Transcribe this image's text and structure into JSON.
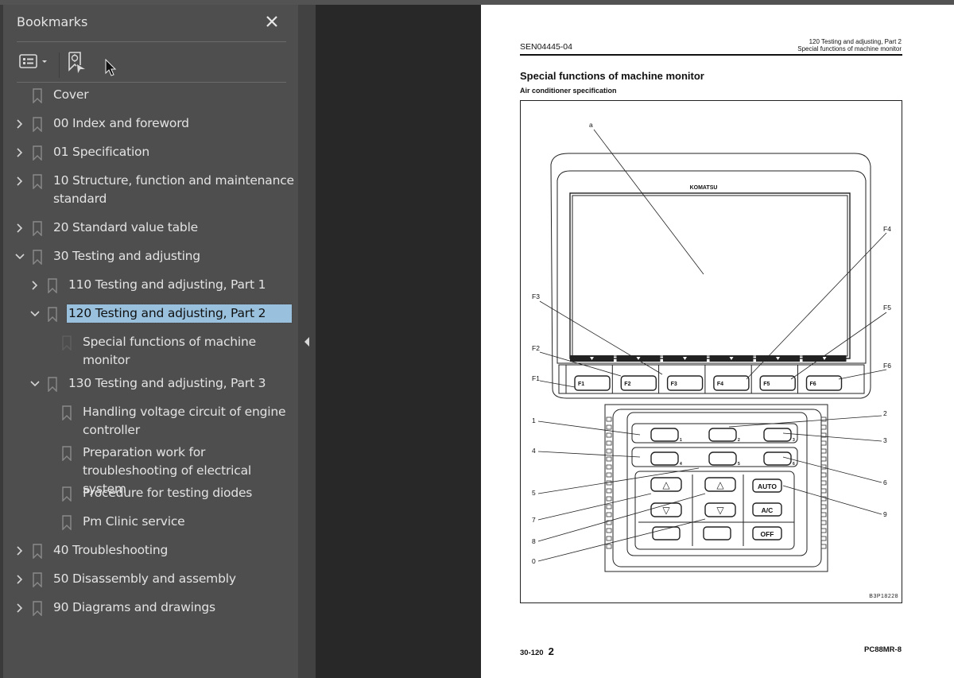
{
  "sidebar": {
    "title": "Bookmarks",
    "close_icon": "close-icon",
    "toolbar": {
      "options_icon": "bookmark-options-icon",
      "find_icon": "find-current-bookmark-icon"
    },
    "items": [
      {
        "label": "Cover",
        "level": 0,
        "expander": "none"
      },
      {
        "label": "00 Index and foreword",
        "level": 0,
        "expander": "collapsed"
      },
      {
        "label": "01 Specification",
        "level": 0,
        "expander": "collapsed"
      },
      {
        "label": "10 Structure, function and maintenance",
        "label2": "standard",
        "level": 0,
        "expander": "collapsed"
      },
      {
        "label": "20 Standard value table",
        "level": 0,
        "expander": "collapsed"
      },
      {
        "label": "30 Testing and adjusting",
        "level": 0,
        "expander": "expanded"
      },
      {
        "label": "110 Testing and adjusting, Part 1",
        "level": 1,
        "expander": "collapsed"
      },
      {
        "label": "120 Testing and adjusting, Part 2",
        "level": 1,
        "expander": "expanded",
        "selected": true
      },
      {
        "label": "Special functions of machine",
        "label2": "monitor",
        "level": 2,
        "expander": "none",
        "current": true
      },
      {
        "label": "130 Testing and adjusting, Part 3",
        "level": 1,
        "expander": "expanded"
      },
      {
        "label": "Handling voltage circuit of engine",
        "label2": "controller",
        "level": 2,
        "expander": "none"
      },
      {
        "label": "Preparation work for",
        "label2": "troubleshooting of electrical system",
        "level": 2,
        "expander": "none"
      },
      {
        "label": "Procedure for testing diodes",
        "level": 2,
        "expander": "none"
      },
      {
        "label": "Pm Clinic service",
        "level": 2,
        "expander": "none"
      },
      {
        "label": "40 Troubleshooting",
        "level": 0,
        "expander": "collapsed"
      },
      {
        "label": "50 Disassembly and assembly",
        "level": 0,
        "expander": "collapsed"
      },
      {
        "label": "90 Diagrams and drawings",
        "level": 0,
        "expander": "collapsed"
      }
    ]
  },
  "colors": {
    "selection": "#99c0dc",
    "panel_bg": "#4e4e4e",
    "viewer_bg": "#282828"
  },
  "page": {
    "doc_id": "SEN04445-04",
    "header_right_1": "120 Testing and adjusting, Part 2",
    "header_right_2": "Special functions of machine monitor",
    "title": "Special functions of machine monitor",
    "subtitle": "Air conditioner specification",
    "figure_code": "B3P18228",
    "footer_page": "30-120",
    "footer_rev": "2",
    "footer_model": "PC88MR-8",
    "figure": {
      "brand": "KOMATSU",
      "callouts_left": [
        "F3",
        "F2",
        "F1",
        "1",
        "4",
        "5",
        "7",
        "8",
        "0"
      ],
      "callouts_right": [
        "F4",
        "F5",
        "F6",
        "2",
        "3",
        "6",
        "9"
      ],
      "callout_top": "a",
      "fkeys": [
        "F1",
        "F2",
        "F3",
        "F4",
        "F5",
        "F6"
      ],
      "ac_buttons": [
        "AUTO",
        "A/C",
        "OFF"
      ],
      "key_numbers": [
        "1",
        "2",
        "3",
        "4",
        "5",
        "6",
        "7",
        "8",
        "9",
        "0"
      ]
    }
  }
}
